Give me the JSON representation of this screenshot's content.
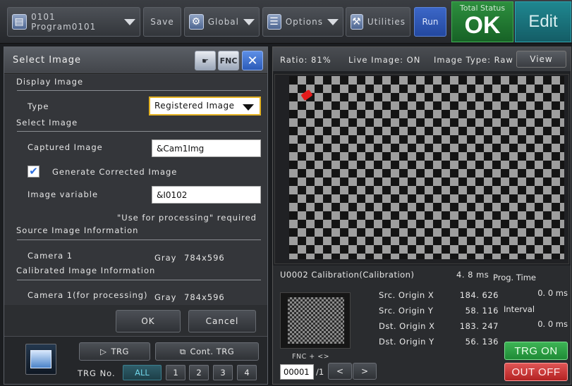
{
  "toolbar": {
    "program": "0101  Program0101",
    "save": "Save",
    "global": "Global",
    "options": "Options",
    "utilities": "Utilities",
    "run": "Run",
    "status_label": "Total Status",
    "status_value": "OK",
    "edit": "Edit",
    "status_color": "#1f7f31"
  },
  "dialog": {
    "title": "Select Image",
    "fnc_label": "FNC",
    "display_image": "Display Image",
    "type_label": "Type",
    "type_value": "Registered Image",
    "select_image": "Select Image",
    "captured_label": "Captured Image",
    "captured_value": "&Cam1Img",
    "generate_corrected": "Generate Corrected Image",
    "generate_checked": true,
    "variable_label": "Image variable",
    "variable_value": "&I0102",
    "use_note": "\"Use for processing\" required",
    "source_info": "Source Image Information",
    "camera1": "Camera 1",
    "camera1_gray": "Gray",
    "camera1_res": "784x596",
    "calibrated_info": "Calibrated Image Information",
    "camera1p": "Camera 1(for processing)",
    "camera1p_gray": "Gray",
    "camera1p_res": "784x596",
    "ok": "OK",
    "cancel": "Cancel"
  },
  "trigger": {
    "trg": "TRG",
    "cont_trg": "Cont. TRG",
    "trg_no": "TRG No.",
    "buttons": [
      "ALL",
      "1",
      "2",
      "3",
      "4"
    ]
  },
  "view": {
    "ratio": "Ratio:  81%",
    "live": "Live  Image:  ON",
    "image_type": "Image Type:  Raw",
    "view_btn": "View"
  },
  "info": {
    "unit": "U0002  Calibration(Calibration)",
    "time": "4. 8 ms",
    "prog_time_label": "Prog.  Time",
    "prog_time_value": "0. 0 ms",
    "interval_label": "Interval",
    "interval_value": "0. 0 ms",
    "measurements": [
      {
        "label": "Src.  Origin  X",
        "value": "184. 626"
      },
      {
        "label": "Src.  Origin  Y",
        "value": "58. 116"
      },
      {
        "label": "Dst.  Origin  X",
        "value": "183. 247"
      },
      {
        "label": "Dst.  Origin  Y",
        "value": "56. 136"
      }
    ],
    "fnc_hint": "FNC  +  <>",
    "page_value": "00001",
    "page_total": "/1",
    "prev": "<",
    "next": ">",
    "trg_on": "TRG ON",
    "out_off": "OUT OFF"
  }
}
